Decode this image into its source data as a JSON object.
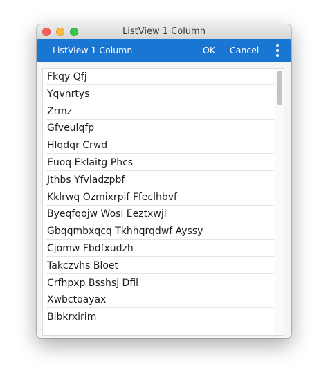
{
  "window": {
    "title": "ListView 1 Column"
  },
  "toolbar": {
    "title": "ListView 1 Column",
    "ok_label": "OK",
    "cancel_label": "Cancel",
    "more_icon": "more-vertical-icon",
    "color": "#1976d2"
  },
  "list": {
    "items": [
      "Fkqy Qfj",
      "Yqvnrtys",
      "Zrmz",
      "Gfveulqfp",
      "Hlqdqr Crwd",
      "Euoq Eklaitg Phcs",
      "Jthbs Yfvladzpbf",
      "Kklrwq Ozmixrpif Ffeclhbvf",
      "Byeqfqojw Wosi Eeztxwjl",
      "Gbqqmbxqcq Tkhhqrqdwf Ayssy",
      "Cjomw Fbdfxudzh",
      "Takczvhs Bloet",
      "Crfhpxp Bsshsj Dfil",
      "Xwbctoayax",
      "Bibkrxirim"
    ]
  }
}
